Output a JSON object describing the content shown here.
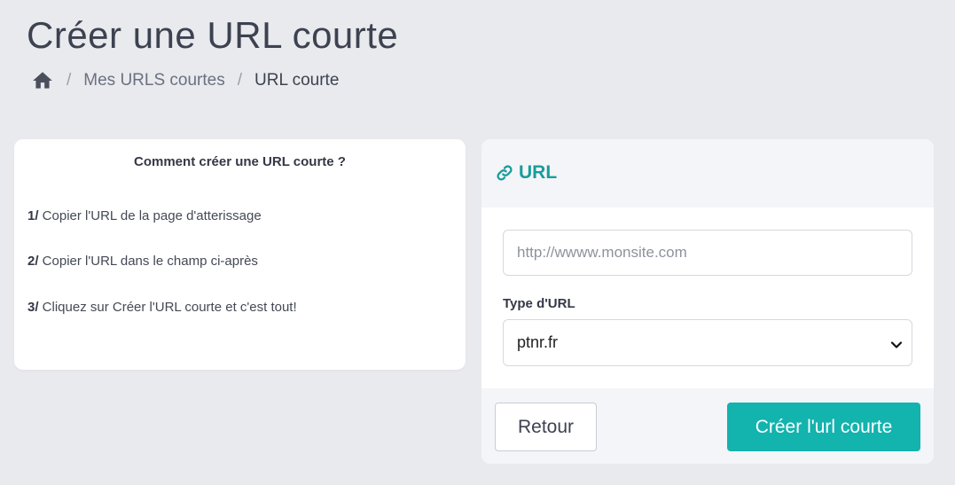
{
  "page": {
    "title": "Créer une URL courte"
  },
  "breadcrumb": {
    "home_icon": "home-icon",
    "separator": "/",
    "items": [
      {
        "label": "Mes URLS courtes"
      },
      {
        "label": "URL courte"
      }
    ]
  },
  "help": {
    "title": "Comment créer une URL courte ?",
    "steps": [
      {
        "num": "1/",
        "text": " Copier l'URL de la page d'atterissage"
      },
      {
        "num": "2/",
        "text": " Copier l'URL dans le champ ci-après"
      },
      {
        "num": "3/",
        "text": " Cliquez sur Créer l'URL courte et c'est tout!"
      }
    ]
  },
  "url_card": {
    "title": "URL",
    "title_icon": "link-icon",
    "accent_color": "#1a9c9c",
    "input": {
      "value": "",
      "placeholder": "http://wwww.monsite.com"
    },
    "type_label": "Type d'URL",
    "type_select": {
      "selected": "ptnr.fr"
    },
    "back_label": "Retour",
    "create_label": "Créer l'url courte",
    "create_color": "#13b3ae"
  }
}
